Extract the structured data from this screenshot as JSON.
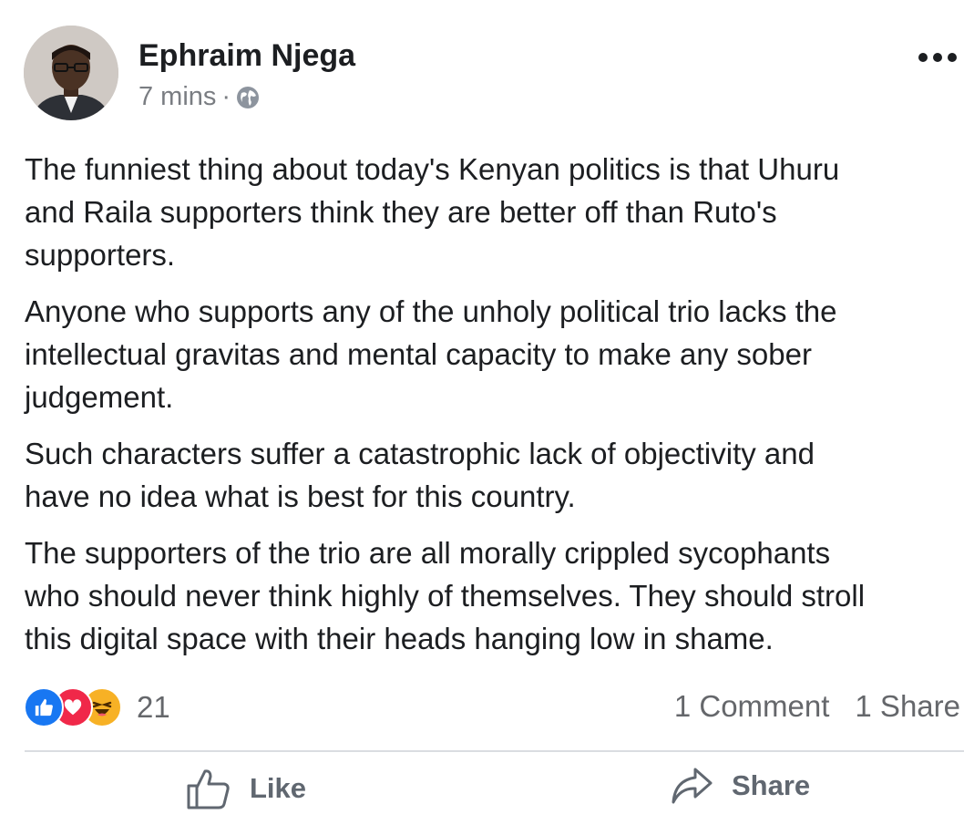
{
  "post": {
    "author": "Ephraim Njega",
    "time": "7 mins",
    "separator": "·",
    "privacy_icon": "globe-icon",
    "paragraphs": [
      [
        "The funniest thing about today's Kenyan politics is that Uhuru",
        "and Raila supporters think they are better off than Ruto's",
        "supporters."
      ],
      [
        "Anyone who supports any of the unholy political trio lacks the",
        "intellectual gravitas and mental capacity to make any sober",
        "judgement."
      ],
      [
        "Such characters suffer a catastrophic lack of objectivity and",
        "have no idea what is best for this country."
      ],
      [
        "The supporters of the trio are all morally crippled sycophants",
        "who should never think highly of themselves. They should stroll",
        "this digital space with their heads hanging low in shame."
      ]
    ]
  },
  "reactions": {
    "icons": [
      "like-reaction-icon",
      "love-reaction-icon",
      "haha-reaction-icon"
    ],
    "count": "21",
    "comments": "1 Comment",
    "shares": "1 Share"
  },
  "actions": {
    "like_label": "Like",
    "share_label": "Share"
  },
  "colors": {
    "like_blue": "#1877f2",
    "love_red": "#f02849",
    "haha_yellow": "#f7b125",
    "text": "#1c1e21",
    "secondary": "#65676b"
  }
}
